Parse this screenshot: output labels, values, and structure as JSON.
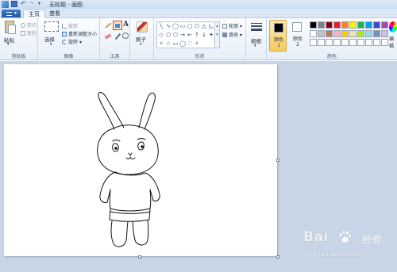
{
  "window": {
    "title": "无标题 - 画图"
  },
  "tabs": [
    {
      "label": "主页"
    },
    {
      "label": "查看"
    }
  ],
  "ribbon": {
    "clipboard": {
      "paste": "粘贴",
      "cut": "剪切",
      "copy": "复制",
      "group": "剪贴板"
    },
    "image": {
      "select": "选择",
      "crop": "裁剪",
      "resize": "重新调整大小",
      "rotate": "旋转",
      "group": "图像"
    },
    "tools": {
      "text_tool": "A",
      "group": "工具"
    },
    "brushes": {
      "label": "刷子"
    },
    "shapes": {
      "items": [
        "╲",
        "∿",
        "◯",
        "▭",
        "▢",
        "⬡",
        "△",
        "◺",
        "◇",
        "⬠",
        "⬡",
        "→",
        "←",
        "↑",
        "↓",
        "✦",
        "✧",
        "☆",
        "▭",
        "◯",
        "♡",
        "⚡"
      ],
      "outline": "轮廓",
      "fill": "填充",
      "group": "形状"
    },
    "size": {
      "label": "粗细"
    },
    "colors": {
      "color1": "颜色 1",
      "color2": "颜色 2",
      "edit": "编辑",
      "group": "颜色",
      "color1_value": "#000000",
      "color2_value": "#ffffff",
      "palette_row1": [
        "#000000",
        "#7f7f7f",
        "#880015",
        "#ed1c24",
        "#ff7f27",
        "#fff200",
        "#22b14c",
        "#00a2e8",
        "#3f48cc",
        "#a349a4"
      ],
      "palette_row2": [
        "#ffffff",
        "#c3c3c3",
        "#b97a57",
        "#ffaec9",
        "#ffc90e",
        "#efe4b0",
        "#b5e61d",
        "#99d9ea",
        "#7092be",
        "#c8bfe7"
      ],
      "palette_row3": [
        "#ffffff",
        "#ffffff",
        "#ffffff",
        "#ffffff",
        "#ffffff",
        "#ffffff",
        "#ffffff",
        "#ffffff",
        "#ffffff",
        "#ffffff"
      ]
    }
  },
  "watermark": {
    "brand": "Bai",
    "brand2": "经验",
    "url": "jingyan.baidu.com"
  }
}
